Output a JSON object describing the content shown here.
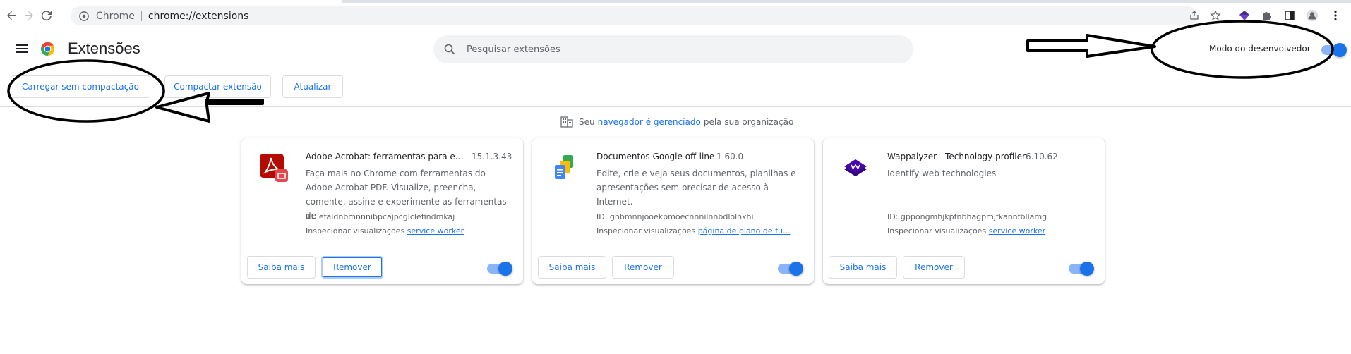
{
  "browser": {
    "site_name": "Chrome",
    "url": "chrome://extensions"
  },
  "header": {
    "title": "Extensões",
    "search_placeholder": "Pesquisar extensões",
    "dev_mode_label": "Modo do desenvolvedor",
    "dev_mode_enabled": true
  },
  "actions": {
    "load_unpacked": "Carregar sem compactação",
    "pack_extension": "Compactar extensão",
    "update": "Atualizar"
  },
  "managed_notice": {
    "prefix": "Seu",
    "link": "navegador é gerenciado",
    "suffix": "pela sua organização"
  },
  "extensions": [
    {
      "name": "Adobe Acrobat: ferramentas para edit...",
      "version": "15.1.3.43",
      "description": "Faça mais no Chrome com ferramentas do Adobe Acrobat PDF. Visualize, preencha, comente, assine e experimente as ferramentas de",
      "id_text": "ID: efaidnbmnnnibpcajpcglclefindmkaj",
      "inspect_label": "Inspecionar visualizações",
      "inspect_link": "service worker",
      "learn_more": "Saiba mais",
      "remove": "Remover",
      "enabled": true,
      "icon": "adobe-acrobat-icon"
    },
    {
      "name": "Documentos Google off-line",
      "version": "1.60.0",
      "description": "Edite, crie e veja seus documentos, planilhas e apresentações sem precisar de acesso à Internet.",
      "id_text": "ID: ghbmnnjooekpmoecnnnilnnbdlolhkhi",
      "inspect_label": "Inspecionar visualizações",
      "inspect_link": "página de plano de fu...",
      "learn_more": "Saiba mais",
      "remove": "Remover",
      "enabled": true,
      "icon": "google-docs-offline-icon"
    },
    {
      "name": "Wappalyzer - Technology profiler",
      "version": "6.10.62",
      "description": "Identify web technologies",
      "id_text": "ID: gppongmhjkpfnbhagpmjfkannfbllamg",
      "inspect_label": "Inspecionar visualizações",
      "inspect_link": "service worker",
      "learn_more": "Saiba mais",
      "remove": "Remover",
      "enabled": true,
      "icon": "wappalyzer-icon"
    }
  ],
  "colors": {
    "accent": "#1a73e8",
    "toggle_track": "#8ab4f8",
    "annotation": "#000000"
  }
}
